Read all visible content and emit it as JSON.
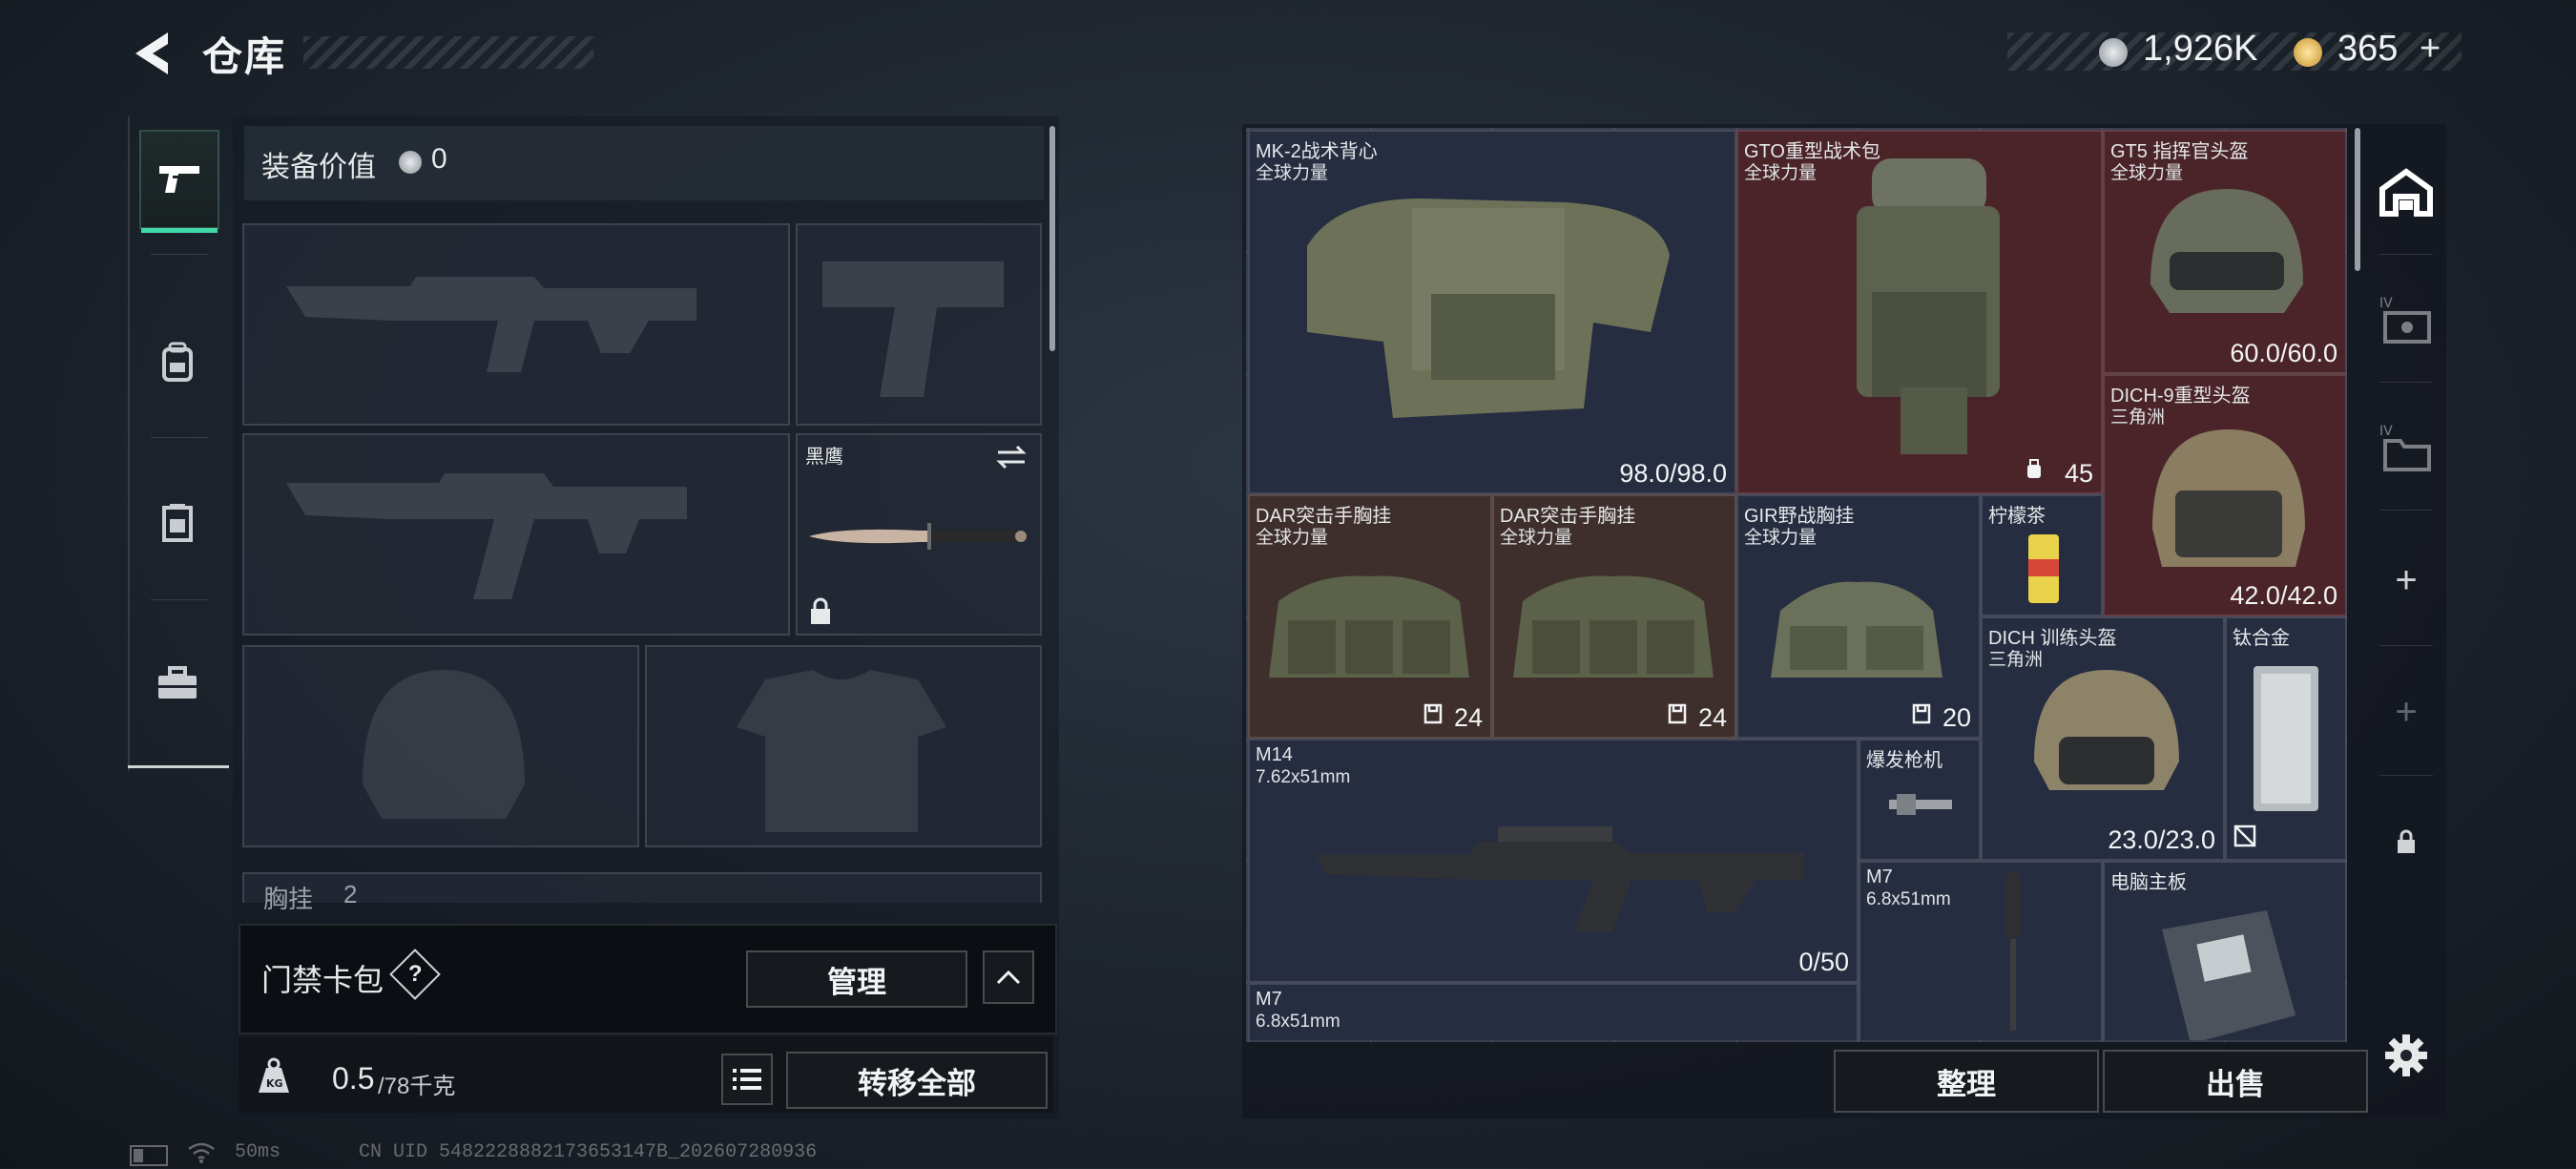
{
  "header": {
    "title": "仓库",
    "currency1": "1,926K",
    "currency2": "365"
  },
  "tabs": [
    "firearm",
    "backpack",
    "chest-rig",
    "case"
  ],
  "equip": {
    "value_label": "装备价值",
    "value": "0",
    "melee_name": "黑鹰",
    "section_label": "胸挂",
    "section_count": "2",
    "card_label": "门禁卡包",
    "manage_label": "管理",
    "weight": "0.5",
    "weight_max": "/78千克",
    "transfer_label": "转移全部"
  },
  "stash": {
    "items": [
      {
        "name": "MK-2战术背心",
        "sub": "全球力量",
        "value": "98.0/98.0"
      },
      {
        "name": "GTO重型战术包",
        "sub": "全球力量",
        "value": "45"
      },
      {
        "name": "GT5 指挥官头盔",
        "sub": "全球力量",
        "value": "60.0/60.0"
      },
      {
        "name": "DICH-9重型头盔",
        "sub": "三角洲",
        "value": "42.0/42.0"
      },
      {
        "name": "DAR突击手胸挂",
        "sub": "全球力量",
        "value": "24"
      },
      {
        "name": "DAR突击手胸挂",
        "sub": "全球力量",
        "value": "24"
      },
      {
        "name": "GIR野战胸挂",
        "sub": "全球力量",
        "value": "20"
      },
      {
        "name": "柠檬茶",
        "sub": "",
        "value": ""
      },
      {
        "name": "DICH 训练头盔",
        "sub": "三角洲",
        "value": "23.0/23.0"
      },
      {
        "name": "钛合金",
        "sub": "",
        "value": ""
      },
      {
        "name": "M14",
        "sub": "7.62x51mm",
        "value": "0/50"
      },
      {
        "name": "爆发枪机",
        "sub": "",
        "value": ""
      },
      {
        "name": "M7",
        "sub": "6.8x51mm",
        "value": ""
      },
      {
        "name": "电脑主板",
        "sub": "",
        "value": ""
      },
      {
        "name": "M7",
        "sub": "6.8x51mm",
        "value": ""
      }
    ],
    "sort_label": "整理",
    "sell_label": "出售"
  },
  "status": {
    "ping": "50ms",
    "uid": "CN UID 5482228882173653147B_202607280936"
  },
  "colors": {
    "accent": "#43d9a6",
    "rare_red": "#4a2429",
    "epic_brown": "#3e2f2c",
    "grid_blue": "#242a3c"
  }
}
